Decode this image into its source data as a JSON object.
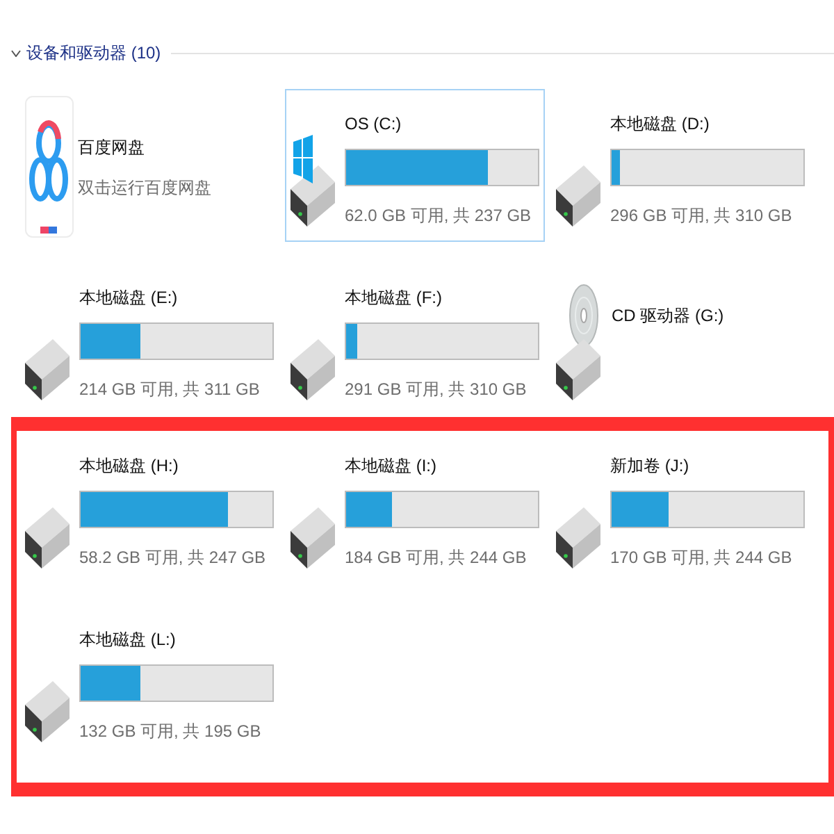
{
  "section": {
    "title": "设备和驱动器 (10)",
    "expanded": true
  },
  "items": [
    {
      "kind": "app",
      "name": "百度网盘",
      "subtitle": "双击运行百度网盘",
      "selected": false
    },
    {
      "kind": "system",
      "name": "OS (C:)",
      "level": 0.74,
      "space": "62.0 GB 可用, 共 237 GB",
      "selected": true
    },
    {
      "kind": "drive",
      "name": "本地磁盘 (D:)",
      "level": 0.04,
      "space": "296 GB 可用, 共 310 GB",
      "selected": false
    },
    {
      "kind": "drive",
      "name": "本地磁盘 (E:)",
      "level": 0.31,
      "space": "214 GB 可用, 共 311 GB",
      "selected": false
    },
    {
      "kind": "drive",
      "name": "本地磁盘 (F:)",
      "level": 0.06,
      "space": "291 GB 可用, 共 310 GB",
      "selected": false
    },
    {
      "kind": "optical",
      "name": "CD 驱动器 (G:)",
      "selected": false
    }
  ],
  "highlight_box": {
    "items": [
      {
        "kind": "drive",
        "name": "本地磁盘 (H:)",
        "level": 0.77,
        "space": "58.2 GB 可用, 共 247 GB",
        "selected": false
      },
      {
        "kind": "drive",
        "name": "本地磁盘 (I:)",
        "level": 0.24,
        "space": "184 GB 可用, 共 244 GB",
        "selected": false
      },
      {
        "kind": "drive",
        "name": "新加卷 (J:)",
        "level": 0.3,
        "space": "170 GB 可用, 共 244 GB",
        "selected": false
      },
      {
        "kind": "drive",
        "name": "本地磁盘 (L:)",
        "level": 0.31,
        "space": "132 GB 可用, 共 195 GB",
        "selected": false
      }
    ]
  }
}
